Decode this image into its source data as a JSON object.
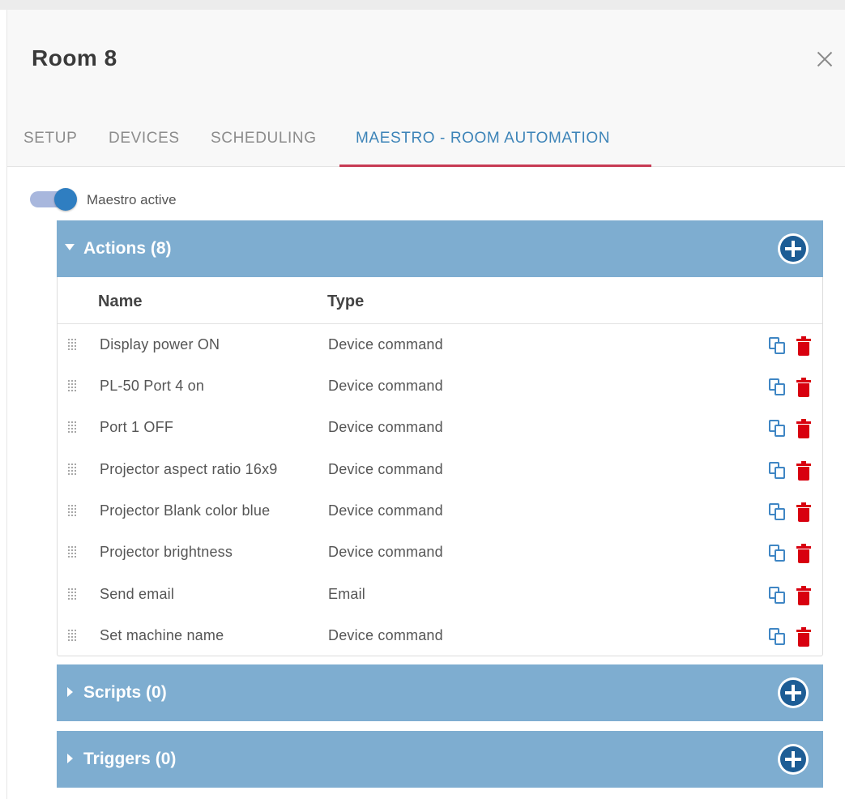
{
  "dialog": {
    "title": "Room 8"
  },
  "tabs": [
    {
      "label": "SETUP"
    },
    {
      "label": "DEVICES"
    },
    {
      "label": "SCHEDULING"
    },
    {
      "label": "MAESTRO - ROOM AUTOMATION",
      "active": true
    }
  ],
  "toggle": {
    "label": "Maestro active",
    "on": true
  },
  "actions": {
    "title": "Actions (8)",
    "expanded": true,
    "columns": {
      "name": "Name",
      "type": "Type"
    },
    "rows": [
      {
        "name": "Display power ON",
        "type": "Device command"
      },
      {
        "name": "PL-50 Port 4 on",
        "type": "Device command"
      },
      {
        "name": "Port 1 OFF",
        "type": "Device command"
      },
      {
        "name": "Projector aspect ratio 16x9",
        "type": "Device command"
      },
      {
        "name": "Projector Blank color blue",
        "type": "Device command"
      },
      {
        "name": "Projector brightness",
        "type": "Device command"
      },
      {
        "name": "Send email",
        "type": "Email"
      },
      {
        "name": "Set machine name",
        "type": "Device command"
      }
    ]
  },
  "scripts": {
    "title": "Scripts (0)",
    "expanded": false
  },
  "triggers": {
    "title": "Triggers (0)",
    "expanded": false
  },
  "icons": {
    "close": "close-icon",
    "add": "plus-circle-icon",
    "copy": "copy-icon",
    "delete": "trash-icon",
    "drag": "drag-handle-icon",
    "expanded": "caret-down-icon",
    "collapsed": "caret-right-icon"
  },
  "colors": {
    "accent": "#3d84b8",
    "tab_underline": "#c73b54",
    "panel_header": "#7eadd0",
    "add_button": "#1d5d95",
    "delete": "#d8000f",
    "copy": "#3f86c4",
    "toggle_knob": "#2f7ec1",
    "toggle_track": "#a8b7dd"
  }
}
